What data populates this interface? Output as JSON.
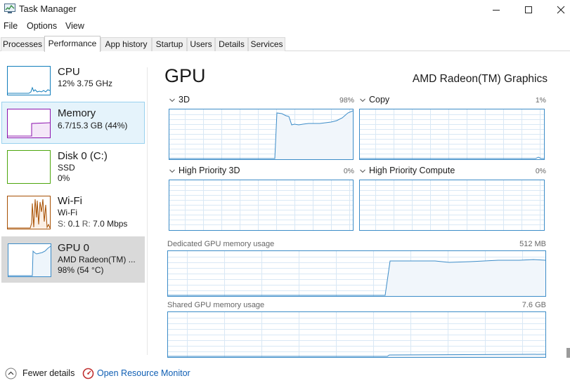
{
  "window": {
    "title": "Task Manager"
  },
  "menu": [
    "File",
    "Options",
    "View"
  ],
  "tabs": [
    "Processes",
    "Performance",
    "App history",
    "Startup",
    "Users",
    "Details",
    "Services"
  ],
  "sidebar": {
    "cpu": {
      "name": "CPU",
      "line1": "12%  3.75 GHz"
    },
    "memory": {
      "name": "Memory",
      "line1": "6.7/15.3 GB (44%)"
    },
    "disk": {
      "name": "Disk 0 (C:)",
      "line1": "SSD",
      "line2": "0%"
    },
    "wifi": {
      "name": "Wi-Fi",
      "line1": "Wi-Fi",
      "send_label": "S:",
      "send_value": "0.1",
      "recv_label": "R:",
      "recv_value": "7.0 Mbps"
    },
    "gpu": {
      "name": "GPU 0",
      "line1": "AMD Radeon(TM) ...",
      "line2": "98% (54 °C)"
    }
  },
  "main": {
    "title": "GPU",
    "model": "AMD Radeon(TM) Graphics",
    "engines": [
      {
        "name": "3D",
        "pct": "98%"
      },
      {
        "name": "Copy",
        "pct": "1%"
      },
      {
        "name": "High Priority 3D",
        "pct": "0%"
      },
      {
        "name": "High Priority Compute",
        "pct": "0%"
      }
    ],
    "dedicated": {
      "label": "Dedicated GPU memory usage",
      "max": "512 MB"
    },
    "shared": {
      "label": "Shared GPU memory usage",
      "max": "7.6 GB"
    }
  },
  "footer": {
    "fewer_details": "Fewer details",
    "resource_monitor": "Open Resource Monitor"
  },
  "colors": {
    "gpu_line": "#3c8cc8",
    "gpu_fill": "#f1f6fb",
    "grid": "#d9e8f5",
    "cpu": "#117dbb",
    "memory": "#8b12ae",
    "disk": "#4da60c",
    "wifi": "#a74f01",
    "sel_memory_bg": "#e5f3fb",
    "sel_memory_border": "#99d1ee",
    "sel_gpu_bg": "#d9d9d9",
    "link": "#0f5fb4"
  }
}
